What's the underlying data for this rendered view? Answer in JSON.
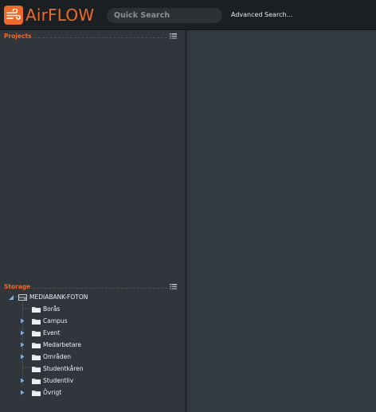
{
  "app": {
    "name": "AirFLOW",
    "brand_color": "#ee6a2b"
  },
  "header": {
    "search_placeholder": "Quick Search",
    "advanced_search_label": "Advanced Search..."
  },
  "projects": {
    "title": "Projects",
    "menu_icon": "list-menu-icon"
  },
  "storage": {
    "title": "Storage",
    "menu_icon": "list-menu-icon",
    "root": {
      "label": "MEDIABANK-FOTON",
      "expanded": true,
      "icon": "drive-icon"
    },
    "folders": [
      {
        "label": "Borås",
        "expandable": false
      },
      {
        "label": "Campus",
        "expandable": true
      },
      {
        "label": "Event",
        "expandable": true
      },
      {
        "label": "Medarbetare",
        "expandable": true
      },
      {
        "label": "Områden",
        "expandable": true
      },
      {
        "label": "Studentkåren",
        "expandable": false
      },
      {
        "label": "Studentliv",
        "expandable": true
      },
      {
        "label": "Övrigt",
        "expandable": true
      }
    ]
  }
}
